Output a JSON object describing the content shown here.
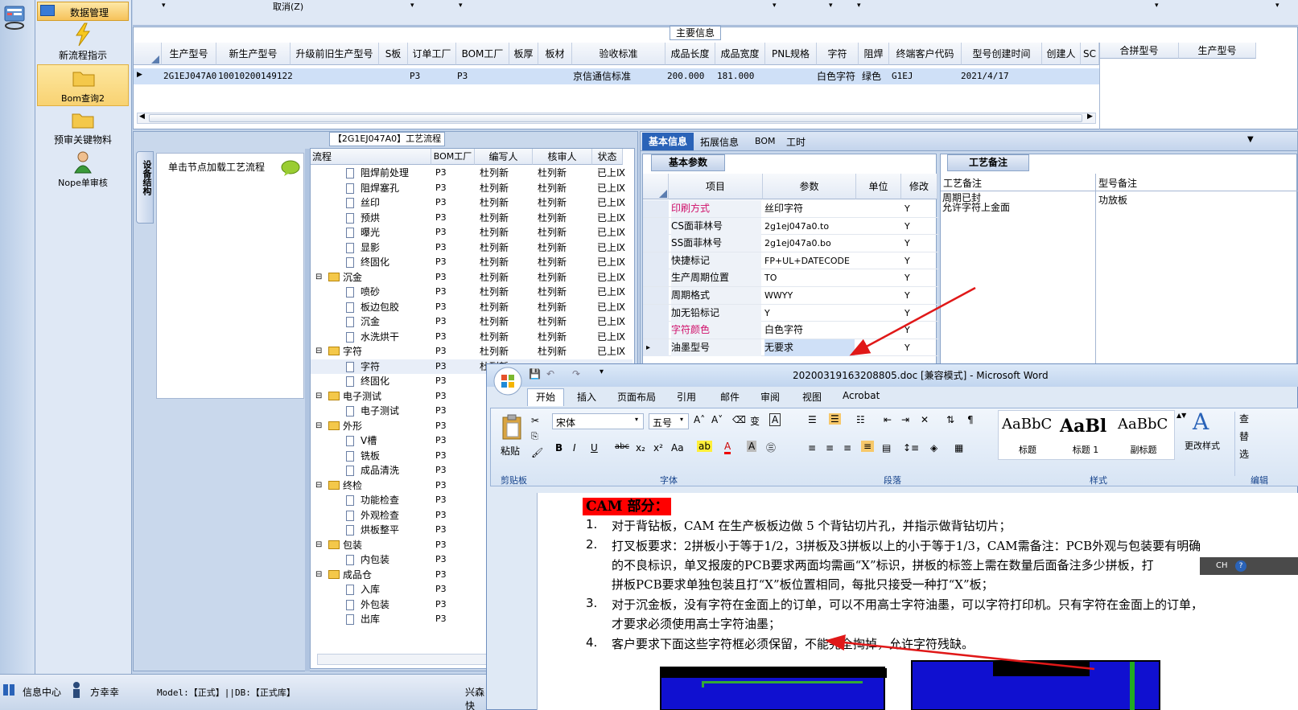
{
  "toolbar": {
    "cancel_label": "取消(Z)"
  },
  "nav": {
    "header": "数据管理",
    "items": [
      {
        "label": "新流程指示",
        "icon": "lightning-icon"
      },
      {
        "label": "Bom查询2",
        "icon": "folder-icon"
      },
      {
        "label": "预审关键物料",
        "icon": "folder-icon"
      },
      {
        "label": "Nope单审核",
        "icon": "user-icon"
      }
    ]
  },
  "main_info": {
    "title": "主要信息",
    "columns": [
      "生产型号",
      "新生产型号",
      "升级前旧生产型号",
      "S板",
      "订单工厂",
      "BOM工厂",
      "板厚",
      "板材",
      "验收标准",
      "成品长度",
      "成品宽度",
      "PNL规格",
      "字符",
      "阻焊",
      "终端客户代码",
      "型号创建时间",
      "创建人",
      "SC"
    ],
    "row": {
      "生产型号": "2G1EJ047A0",
      "新生产型号": "10010200149122",
      "订单工厂": "P3",
      "BOM工厂": "P3",
      "验收标准": "京信通信标准",
      "成品长度": "200.000",
      "成品宽度": "181.000",
      "字符": "白色字符",
      "阻焊": "绿色",
      "终端客户代码": "G1EJ",
      "型号创建时间": "2021/4/17"
    },
    "merge_columns": [
      "合拼型号",
      "生产型号"
    ]
  },
  "flow": {
    "title": "【2G1EJ047A0】工艺流程",
    "side_tab": "设备结构",
    "hint": "单击节点加载工艺流程",
    "columns": [
      "流程",
      "BOM工厂",
      "编写人",
      "核审人",
      "状态"
    ],
    "rows": [
      {
        "name": "阻焊前处理",
        "level": 2,
        "factory": "P3",
        "author": "杜列新",
        "reviewer": "杜列新",
        "status": "已上Ⅸ"
      },
      {
        "name": "阻焊塞孔",
        "level": 2,
        "factory": "P3",
        "author": "杜列新",
        "reviewer": "杜列新",
        "status": "已上Ⅸ"
      },
      {
        "name": "丝印",
        "level": 2,
        "factory": "P3",
        "author": "杜列新",
        "reviewer": "杜列新",
        "status": "已上Ⅸ"
      },
      {
        "name": "预烘",
        "level": 2,
        "factory": "P3",
        "author": "杜列新",
        "reviewer": "杜列新",
        "status": "已上Ⅸ"
      },
      {
        "name": "曝光",
        "level": 2,
        "factory": "P3",
        "author": "杜列新",
        "reviewer": "杜列新",
        "status": "已上Ⅸ"
      },
      {
        "name": "显影",
        "level": 2,
        "factory": "P3",
        "author": "杜列新",
        "reviewer": "杜列新",
        "status": "已上Ⅸ"
      },
      {
        "name": "终固化",
        "level": 2,
        "factory": "P3",
        "author": "杜列新",
        "reviewer": "杜列新",
        "status": "已上Ⅸ"
      },
      {
        "name": "沉金",
        "level": 1,
        "factory": "P3",
        "author": "杜列新",
        "reviewer": "杜列新",
        "status": "已上Ⅸ"
      },
      {
        "name": "喷砂",
        "level": 2,
        "factory": "P3",
        "author": "杜列新",
        "reviewer": "杜列新",
        "status": "已上Ⅸ"
      },
      {
        "name": "板边包胶",
        "level": 2,
        "factory": "P3",
        "author": "杜列新",
        "reviewer": "杜列新",
        "status": "已上Ⅸ"
      },
      {
        "name": "沉金",
        "level": 2,
        "factory": "P3",
        "author": "杜列新",
        "reviewer": "杜列新",
        "status": "已上Ⅸ"
      },
      {
        "name": "水洗烘干",
        "level": 2,
        "factory": "P3",
        "author": "杜列新",
        "reviewer": "杜列新",
        "status": "已上Ⅸ"
      },
      {
        "name": "字符",
        "level": 1,
        "factory": "P3",
        "author": "杜列新",
        "reviewer": "杜列新",
        "status": "已上Ⅸ"
      },
      {
        "name": "字符",
        "level": 2,
        "factory": "P3",
        "author": "杜列新",
        "reviewer": "",
        "status": ""
      },
      {
        "name": "终固化",
        "level": 2,
        "factory": "P3",
        "author": "",
        "reviewer": "",
        "status": ""
      },
      {
        "name": "电子测试",
        "level": 1,
        "factory": "P3",
        "author": "",
        "reviewer": "",
        "status": ""
      },
      {
        "name": "电子测试",
        "level": 2,
        "factory": "P3",
        "author": "",
        "reviewer": "",
        "status": ""
      },
      {
        "name": "外形",
        "level": 1,
        "factory": "P3",
        "author": "",
        "reviewer": "",
        "status": ""
      },
      {
        "name": "V槽",
        "level": 2,
        "factory": "P3",
        "author": "",
        "reviewer": "",
        "status": ""
      },
      {
        "name": "铣板",
        "level": 2,
        "factory": "P3",
        "author": "",
        "reviewer": "",
        "status": ""
      },
      {
        "name": "成品清洗",
        "level": 2,
        "factory": "P3",
        "author": "",
        "reviewer": "",
        "status": ""
      },
      {
        "name": "终检",
        "level": 1,
        "factory": "P3",
        "author": "",
        "reviewer": "",
        "status": ""
      },
      {
        "name": "功能检查",
        "level": 2,
        "factory": "P3",
        "author": "",
        "reviewer": "",
        "status": ""
      },
      {
        "name": "外观检查",
        "level": 2,
        "factory": "P3",
        "author": "",
        "reviewer": "",
        "status": ""
      },
      {
        "name": "烘板整平",
        "level": 2,
        "factory": "P3",
        "author": "",
        "reviewer": "",
        "status": ""
      },
      {
        "name": "包装",
        "level": 1,
        "factory": "P3",
        "author": "",
        "reviewer": "",
        "status": ""
      },
      {
        "name": "内包装",
        "level": 2,
        "factory": "P3",
        "author": "",
        "reviewer": "",
        "status": ""
      },
      {
        "name": "成品仓",
        "level": 1,
        "factory": "P3",
        "author": "",
        "reviewer": "",
        "status": ""
      },
      {
        "name": "入库",
        "level": 2,
        "factory": "P3",
        "author": "",
        "reviewer": "",
        "status": ""
      },
      {
        "name": "外包装",
        "level": 2,
        "factory": "P3",
        "author": "",
        "reviewer": "",
        "status": ""
      },
      {
        "name": "出库",
        "level": 2,
        "factory": "P3",
        "author": "",
        "reviewer": "",
        "status": ""
      }
    ]
  },
  "detail": {
    "tabs": [
      "基本信息",
      "拓展信息",
      "BOM",
      "工时"
    ],
    "subtab": "基本参数",
    "columns": [
      "项目",
      "参数",
      "单位",
      "修改"
    ],
    "rows": [
      {
        "item": "印刷方式",
        "value": "丝印字符",
        "unit": "",
        "mod": "Y",
        "red": true
      },
      {
        "item": "CS面菲林号",
        "value": "2g1ej047a0.to",
        "unit": "",
        "mod": "Y",
        "red": false
      },
      {
        "item": "SS面菲林号",
        "value": "2g1ej047a0.bo",
        "unit": "",
        "mod": "Y",
        "red": false
      },
      {
        "item": "快捷标记",
        "value": "FP+UL+DATECODE",
        "unit": "",
        "mod": "Y",
        "red": false
      },
      {
        "item": "生产周期位置",
        "value": "TO",
        "unit": "",
        "mod": "Y",
        "red": false
      },
      {
        "item": "周期格式",
        "value": "WWYY",
        "unit": "",
        "mod": "Y",
        "red": false
      },
      {
        "item": "加无铅标记",
        "value": "Y",
        "unit": "",
        "mod": "Y",
        "red": false
      },
      {
        "item": "字符颜色",
        "value": "白色字符",
        "unit": "",
        "mod": "Y",
        "red": true
      },
      {
        "item": "油墨型号",
        "value": "无要求",
        "unit": "",
        "mod": "Y",
        "red": false
      }
    ],
    "craft_tab": "工艺备注",
    "craft_columns": [
      "工艺备注",
      "型号备注"
    ],
    "craft_note": "周期已封\n允许字符上金面",
    "model_note": "功放板"
  },
  "word": {
    "title": "20200319163208805.doc [兼容模式] - Microsoft Word",
    "tabs": [
      "开始",
      "插入",
      "页面布局",
      "引用",
      "邮件",
      "审阅",
      "视图",
      "Acrobat"
    ],
    "font": "宋体",
    "size": "五号",
    "styles": [
      {
        "sample": "AaBbC",
        "name": "标题"
      },
      {
        "sample": "AaBl",
        "name": "标题 1"
      },
      {
        "sample": "AaBbC",
        "name": "副标题"
      }
    ],
    "group_labels": [
      "剪贴板",
      "字体",
      "段落",
      "样式",
      "编辑"
    ],
    "paste_label": "粘贴",
    "change_style": "更改样式",
    "edit_items": [
      "查",
      "替",
      "选"
    ],
    "ime": "CH",
    "heading": "CAM 部分：",
    "paragraphs": [
      {
        "num": "1.",
        "lines": [
          "对于背钻板，CAM 在生产板板边做 5 个背钻切片孔，并指示做背钻切片；"
        ]
      },
      {
        "num": "2.",
        "lines": [
          "打叉板要求：2拼板小于等于1/2，3拼板及3拼板以上的小于等于1/3，CAM需备注：PCB外观与包装要有明确",
          "的不良标识，单叉报废的PCB要求两面均需画“X”标识，拼板的标签上需在数量后面备注多少拼板，打",
          "拼板PCB要求单独包装且打“X”板位置相同，每批只接受一种打“X”板；"
        ]
      },
      {
        "num": "3.",
        "lines": [
          "对于沉金板，没有字符在金面上的订单，可以不用高士字符油墨，可以字符打印机。只有字符在金面上的订单，",
          "才要求必须使用高士字符油墨；"
        ]
      },
      {
        "num": "4.",
        "lines": [
          "客户要求下面这些字符框必须保留，不能完全掏掉，允许字符残缺。"
        ]
      }
    ]
  },
  "status": {
    "info_center": "信息中心",
    "user": "方幸幸",
    "model": "Model:【正式】||DB:【正式库】",
    "extra": "兴森快"
  }
}
